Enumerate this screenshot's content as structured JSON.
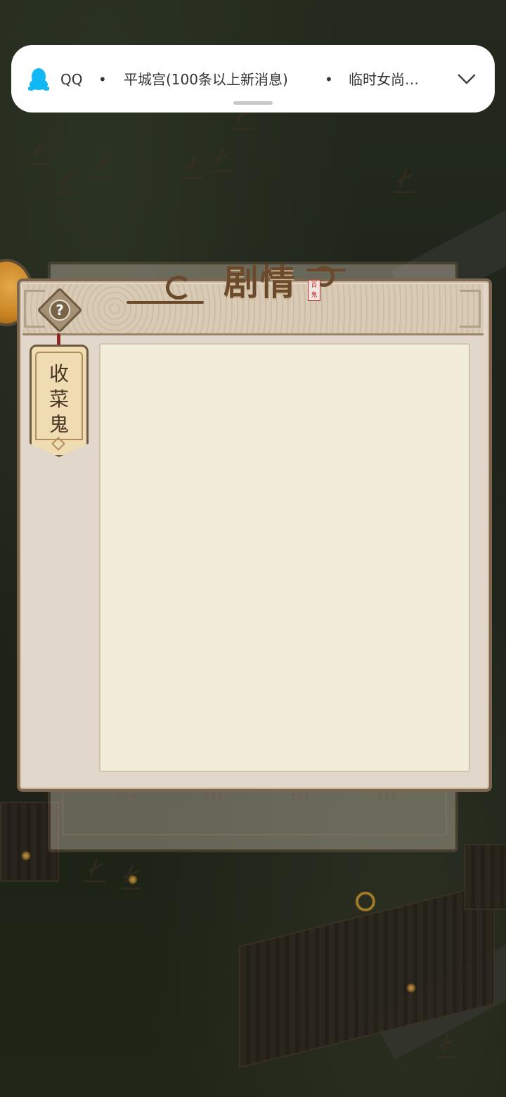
{
  "notification": {
    "app_name": "QQ",
    "separator": "•",
    "title": "平城宫(100条以上新消息)",
    "message": "临时女尚…",
    "icon": "qq-penguin-icon",
    "expand_icon": "chevron-down-icon"
  },
  "dialog": {
    "title": "剧情",
    "seal_text": "百鬼",
    "help_label": "?",
    "story_tabs": [
      {
        "label_chars": [
          "收",
          "菜",
          "鬼"
        ]
      }
    ]
  },
  "background_panel": {
    "slots": [
      "???",
      "???",
      "???",
      "???"
    ]
  },
  "colors": {
    "panel_border": "#7d6650",
    "panel_bg": "#e1d7ca",
    "content_bg": "#f2eddb",
    "title_brown": "#6b4a2c",
    "tag_bg": "#f0dcb2",
    "string_red": "#8a2a22",
    "seal_red": "#c7342b"
  }
}
